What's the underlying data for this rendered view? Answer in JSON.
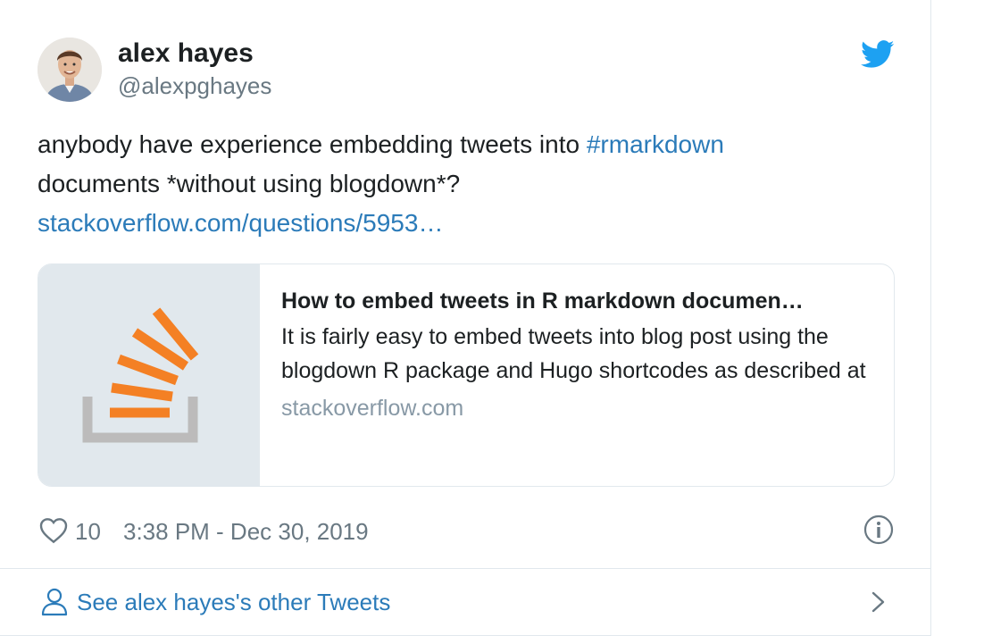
{
  "author": {
    "name": "alex hayes",
    "handle": "@alexpghayes"
  },
  "tweet": {
    "text_before": "anybody have experience embedding tweets into ",
    "hashtag": "#rmarkdown",
    "text_after": " documents *without using blogdown*?",
    "url": "stackoverflow.com/questions/5953…"
  },
  "card": {
    "title": "How to embed tweets in R markdown documen…",
    "description": "It is fairly easy to embed tweets into blog post using the blogdown R package and Hugo shortcodes as described at",
    "domain": "stackoverflow.com"
  },
  "footer": {
    "likes": "10",
    "timestamp": "3:38 PM - Dec 30, 2019"
  },
  "see_more": {
    "label": "See alex hayes's other Tweets"
  },
  "icons": {
    "logo": "twitter-bird-icon",
    "like": "heart-icon",
    "info": "info-icon",
    "user": "user-icon",
    "chevron": "chevron-right-icon",
    "thumbnail": "stackoverflow-logo"
  },
  "colors": {
    "twitter_blue": "#1da1f2",
    "link": "#2b7bb9",
    "secondary_text": "#697882",
    "border": "#e1e8ed",
    "so_orange": "#f48024",
    "so_gray": "#bcbbbb"
  }
}
